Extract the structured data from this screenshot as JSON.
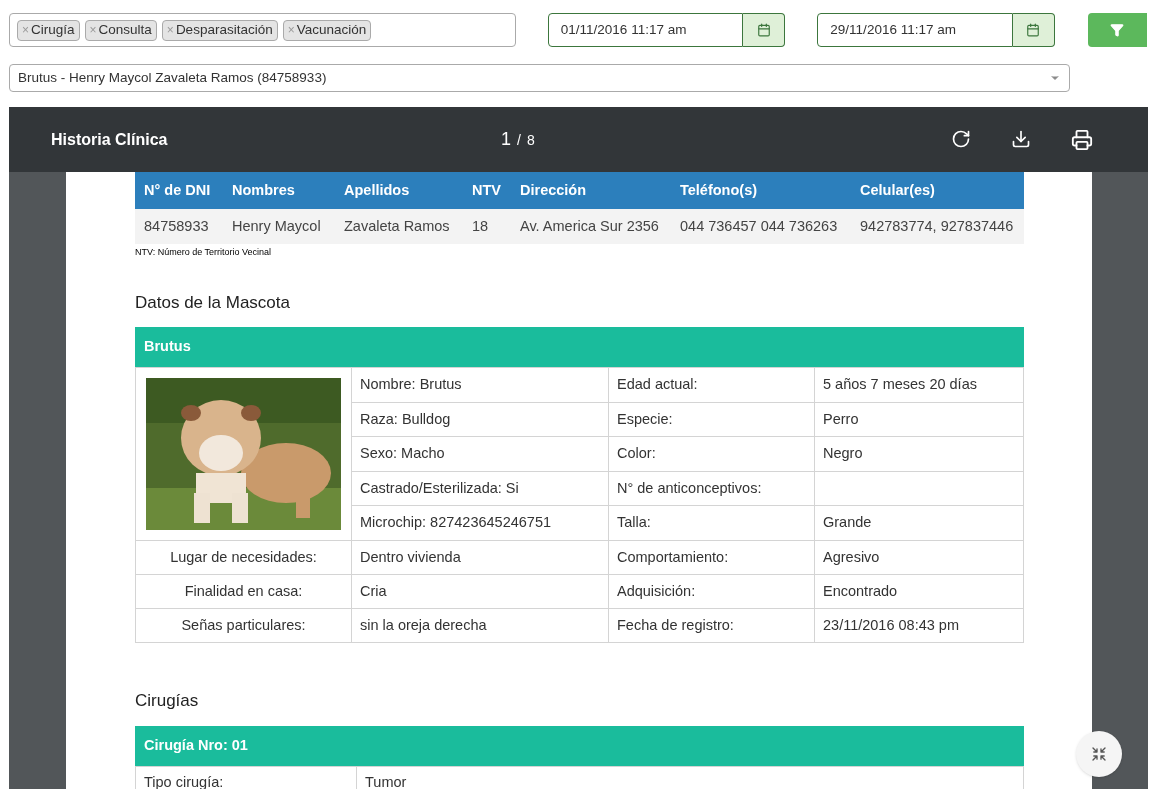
{
  "filters": {
    "tags": [
      {
        "label": "Cirugía"
      },
      {
        "label": "Consulta"
      },
      {
        "label": "Desparasitación"
      },
      {
        "label": "Vacunación"
      }
    ],
    "tag_remove": "×",
    "date_from": "01/11/2016 11:17 am",
    "date_to": "29/11/2016 11:17 am",
    "patient": "Brutus - Henry Maycol Zavaleta Ramos (84758933)"
  },
  "viewer": {
    "title": "Historia Clínica",
    "page": "1",
    "separator": "/",
    "total": "8"
  },
  "owner_table": {
    "columns": [
      "N° de DNI",
      "Nombres",
      "Apellidos",
      "NTV",
      "Dirección",
      "Teléfono(s)",
      "Celular(es)"
    ],
    "rows": [
      [
        "84758933",
        "Henry Maycol",
        "Zavaleta Ramos",
        "18",
        "Av. America Sur 2356",
        "044 736457 044 736263",
        "942783774, 927837446"
      ]
    ],
    "footnote": "NTV: Número de Territorio Vecinal"
  },
  "pet": {
    "heading": "Datos de la Mascota",
    "name": "Brutus",
    "photo": {
      "kind": "picture"
    },
    "photo_rows": [
      [
        "Nombre: Brutus",
        "Edad actual:",
        "5 años 7 meses 20 días"
      ],
      [
        "Raza: Bulldog",
        "Especie:",
        "Perro"
      ],
      [
        "Sexo: Macho",
        "Color:",
        "Negro"
      ],
      [
        "Castrado/Esterilizada: Si",
        "N° de anticonceptivos:",
        ""
      ],
      [
        "Microchip: 827423645246751",
        "Talla:",
        "Grande"
      ]
    ],
    "rows": [
      [
        "Lugar de necesidades:",
        "Dentro vivienda",
        "Comportamiento:",
        "Agresivo"
      ],
      [
        "Finalidad en casa:",
        "Cria",
        "Adquisición:",
        "Encontrado"
      ],
      [
        "Señas particulares:",
        "sin la oreja derecha",
        "Fecha de registro:",
        "23/11/2016 08:43 pm"
      ]
    ]
  },
  "surgeries": {
    "heading": "Cirugías",
    "cards": [
      {
        "title": "Cirugía Nro: 01",
        "rows": [
          [
            "Tipo cirugía:",
            "Tumor"
          ]
        ]
      }
    ]
  }
}
